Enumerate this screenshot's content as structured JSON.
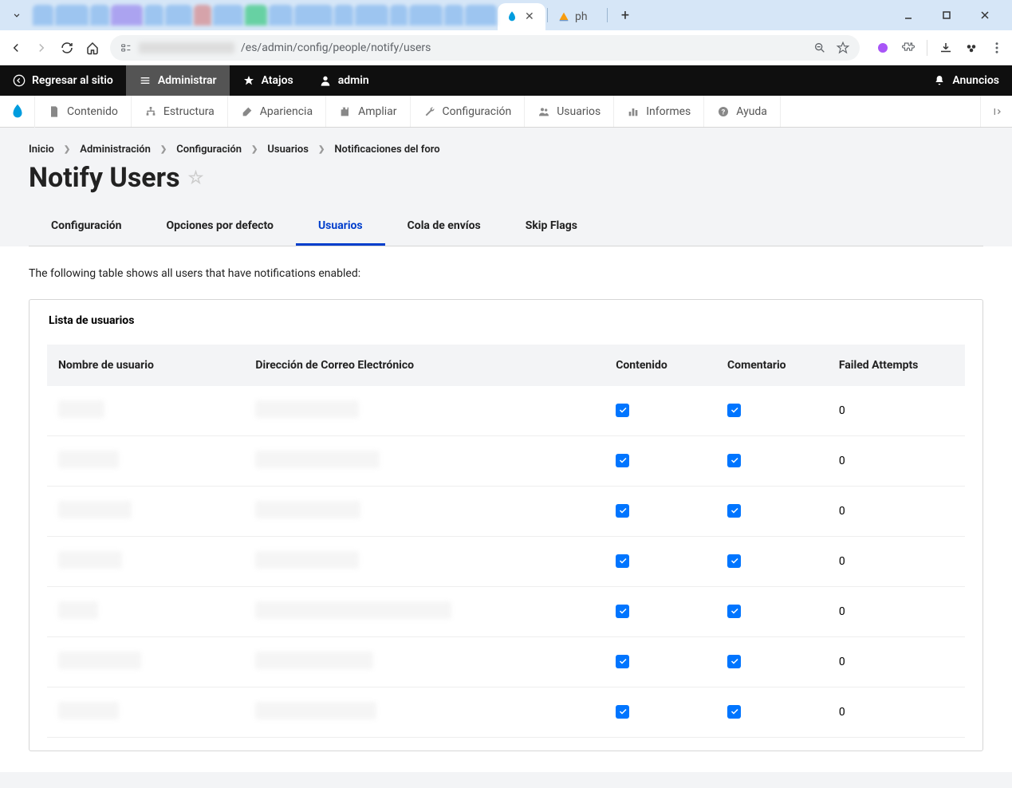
{
  "browser": {
    "tabs": {
      "inactive_label": "ph",
      "close_x": "✕",
      "add": "+"
    },
    "address": {
      "path": "/es/admin/config/people/notify/users"
    }
  },
  "toolbar": {
    "back_to_site": "Regresar al sitio",
    "manage": "Administrar",
    "shortcuts": "Atajos",
    "user": "admin",
    "announcements": "Anuncios"
  },
  "admin_menu": {
    "content": "Contenido",
    "structure": "Estructura",
    "appearance": "Apariencia",
    "extend": "Ampliar",
    "configuration": "Configuración",
    "people": "Usuarios",
    "reports": "Informes",
    "help": "Ayuda"
  },
  "breadcrumb": {
    "home": "Inicio",
    "admin": "Administración",
    "config": "Configuración",
    "users": "Usuarios",
    "notify": "Notificaciones del foro"
  },
  "page_title": "Notify Users",
  "tabs": {
    "config": "Configuración",
    "defaults": "Opciones por defecto",
    "users": "Usuarios",
    "queue": "Cola de envíos",
    "skip": "Skip Flags"
  },
  "description": "The following table shows all users that have notifications enabled:",
  "fieldset_legend": "Lista de usuarios",
  "table": {
    "headers": {
      "username": "Nombre de usuario",
      "email": "Dirección de Correo Electrónico",
      "content": "Contenido",
      "comment": "Comentario",
      "failed": "Failed Attempts"
    },
    "rows": [
      {
        "user_w": 58,
        "email_w": 130,
        "content": true,
        "comment": true,
        "failed": "0"
      },
      {
        "user_w": 76,
        "email_w": 156,
        "content": true,
        "comment": true,
        "failed": "0"
      },
      {
        "user_w": 92,
        "email_w": 132,
        "content": true,
        "comment": true,
        "failed": "0"
      },
      {
        "user_w": 80,
        "email_w": 130,
        "content": true,
        "comment": true,
        "failed": "0"
      },
      {
        "user_w": 50,
        "email_w": 246,
        "content": true,
        "comment": true,
        "failed": "0"
      },
      {
        "user_w": 104,
        "email_w": 148,
        "content": true,
        "comment": true,
        "failed": "0"
      },
      {
        "user_w": 76,
        "email_w": 152,
        "content": true,
        "comment": true,
        "failed": "0"
      }
    ]
  }
}
